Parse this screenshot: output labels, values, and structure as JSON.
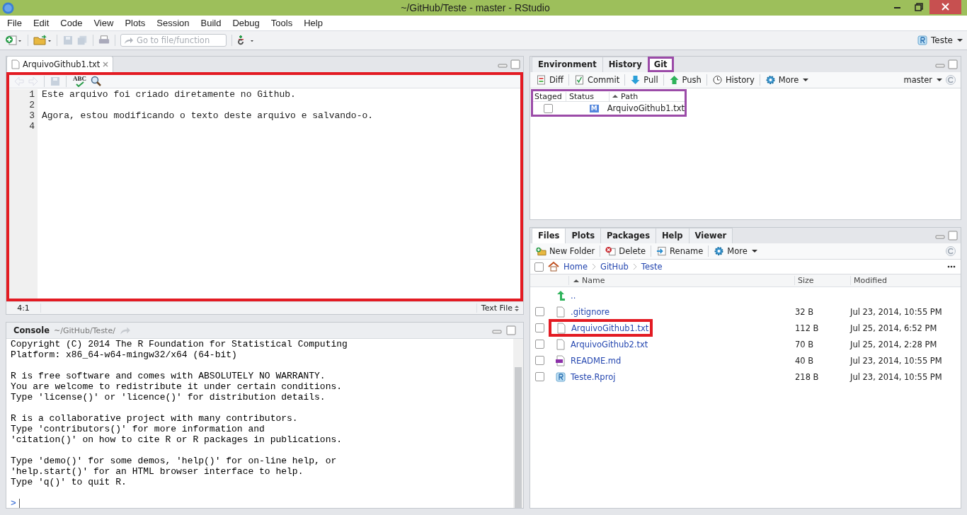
{
  "window": {
    "title": "~/GitHub/Teste - master - RStudio"
  },
  "menu": [
    "File",
    "Edit",
    "Code",
    "View",
    "Plots",
    "Session",
    "Build",
    "Debug",
    "Tools",
    "Help"
  ],
  "toolbar": {
    "goto_placeholder": "Go to file/function",
    "project": "Teste"
  },
  "editor": {
    "tab": "ArquivoGithub1.txt",
    "highlighted": true,
    "spell_label": "ABC",
    "lines": [
      {
        "number": "1",
        "text": "Este arquivo foi criado diretamente no Github."
      },
      {
        "number": "2"
      },
      {
        "number": "3",
        "text": "Agora, estou modificando o texto deste arquivo e salvando-o."
      },
      {
        "number": "4"
      }
    ],
    "position": "4:1",
    "file_type": "Text File"
  },
  "console": {
    "title": "Console",
    "path": "~/GitHub/Teste/",
    "paragraphs": [
      [
        "Copyright (C) 2014 The R Foundation for Statistical Computing",
        "Platform: x86_64-w64-mingw32/x64 (64-bit)"
      ],
      [
        "R is free software and comes with ABSOLUTELY NO WARRANTY.",
        "You are welcome to redistribute it under certain conditions.",
        "Type 'license()' or 'licence()' for distribution details."
      ],
      [
        "R is a collaborative project with many contributors.",
        "Type 'contributors()' for more information and",
        "'citation()' on how to cite R or R packages in publications."
      ],
      [
        "Type 'demo()' for some demos, 'help()' for on-line help, or",
        "'help.start()' for an HTML browser interface to help.",
        "Type 'q()' to quit R."
      ]
    ],
    "prompt": ">"
  },
  "git_pane": {
    "tabs": [
      {
        "label": "Environment",
        "selected": false,
        "highlighted": false
      },
      {
        "label": "History",
        "selected": false,
        "highlighted": false
      },
      {
        "label": "Git",
        "selected": true,
        "highlighted": true
      }
    ],
    "actions": [
      {
        "kind": "diff",
        "label": "Diff"
      },
      {
        "kind": "commit",
        "label": "Commit"
      },
      {
        "kind": "pull",
        "label": "Pull"
      },
      {
        "kind": "push",
        "label": "Push"
      },
      {
        "kind": "history",
        "label": "History"
      },
      {
        "kind": "more",
        "label": "More"
      }
    ],
    "branch": "master",
    "table_highlighted": true,
    "columns": [
      "Staged",
      "Status",
      "Path"
    ],
    "rows": [
      {
        "staged": false,
        "status": "M",
        "path": "ArquivoGithub1.txt"
      }
    ]
  },
  "files_pane": {
    "tabs": [
      {
        "label": "Files",
        "selected": true
      },
      {
        "label": "Plots",
        "selected": false
      },
      {
        "label": "Packages",
        "selected": false
      },
      {
        "label": "Help",
        "selected": false
      },
      {
        "label": "Viewer",
        "selected": false
      }
    ],
    "actions": [
      {
        "kind": "new-folder",
        "label": "New Folder"
      },
      {
        "kind": "delete",
        "label": "Delete"
      },
      {
        "kind": "rename",
        "label": "Rename"
      },
      {
        "kind": "more",
        "label": "More"
      }
    ],
    "select_all_checked": false,
    "breadcrumb": [
      "Home",
      "GitHub",
      "Teste"
    ],
    "columns": [
      "Name",
      "Size",
      "Modified"
    ],
    "rows": [
      {
        "kind": "up",
        "name": ".."
      },
      {
        "kind": "file",
        "name": ".gitignore",
        "size": "32 B",
        "modified": "Jul 23, 2014, 10:55 PM",
        "checked": false,
        "highlighted": false
      },
      {
        "kind": "file",
        "name": "ArquivoGithub1.txt",
        "size": "112 B",
        "modified": "Jul 25, 2014, 6:52 PM",
        "checked": false,
        "highlighted": true
      },
      {
        "kind": "file",
        "name": "ArquivoGithub2.txt",
        "size": "70 B",
        "modified": "Jul 25, 2014, 2:28 PM",
        "checked": false,
        "highlighted": false
      },
      {
        "kind": "md",
        "name": "README.md",
        "size": "40 B",
        "modified": "Jul 23, 2014, 10:55 PM",
        "checked": false,
        "highlighted": false
      },
      {
        "kind": "rproj",
        "name": "Teste.Rproj",
        "size": "218 B",
        "modified": "Jul 23, 2014, 10:55 PM",
        "checked": false,
        "highlighted": false
      }
    ]
  }
}
